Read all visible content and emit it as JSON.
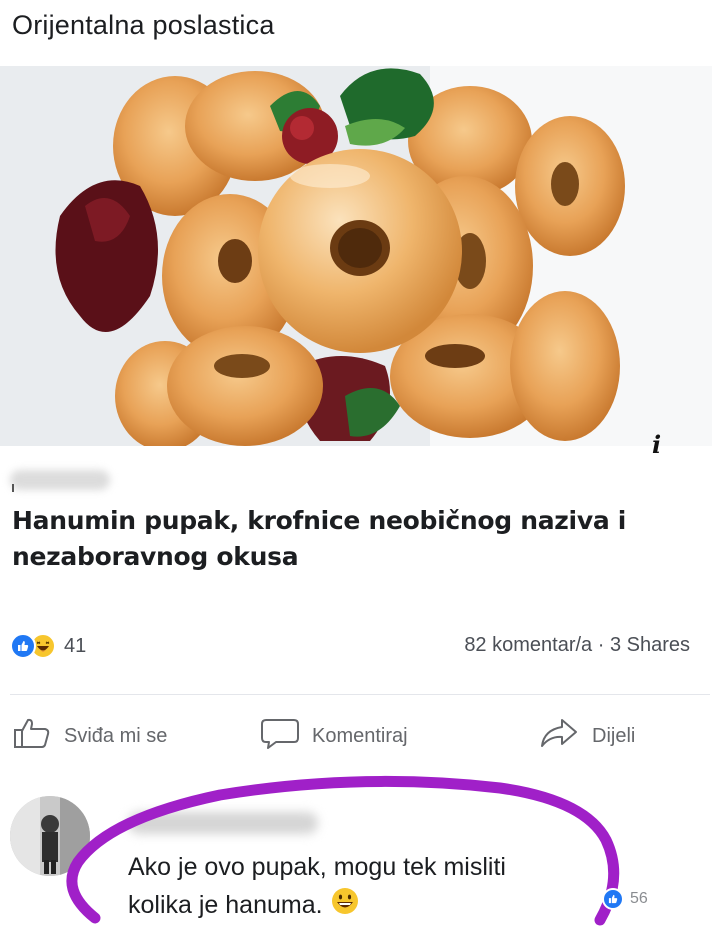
{
  "page": {
    "title": "Orijentalna poslastica"
  },
  "post": {
    "headline": "Hanumin pupak, krofnice neobičnog naziva i nezaboravnog okusa",
    "info_icon": "i",
    "reactions_count": "41",
    "stats": "82 komentar/a · 3 Shares"
  },
  "actions": {
    "like_label": "Sviđa mi se",
    "comment_label": "Komentiraj",
    "share_label": "Dijeli"
  },
  "comment": {
    "text": "Ako je ovo pupak, mogu tek misliti kolika je hanuma.",
    "reaction_count": "56"
  },
  "icons": {
    "like": "thumbs-up-icon",
    "comment": "speech-bubble-icon",
    "share": "share-arrow-icon",
    "reaction_like": "like-reaction-icon",
    "reaction_haha": "haha-reaction-icon",
    "emoji": "grinning-emoji-icon"
  },
  "colors": {
    "like_blue": "#2078f4",
    "haha_yellow": "#f7c62d",
    "highlight_purple": "#a020c8",
    "muted_text": "#65676b"
  }
}
